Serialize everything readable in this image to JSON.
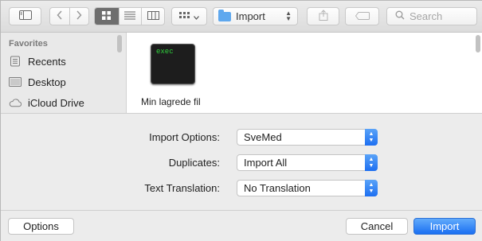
{
  "toolbar": {
    "sidebar_toggle_icon": "sidebar-icon",
    "back_icon": "chevron-left-icon",
    "forward_icon": "chevron-right-icon",
    "view_modes": [
      "icon-view",
      "list-view",
      "column-view"
    ],
    "active_view": "icon-view",
    "arrange_icon": "grid-arrange-icon",
    "location": "Import",
    "share_icon": "share-icon",
    "tag_icon": "tag-icon",
    "search_placeholder": "Search"
  },
  "sidebar": {
    "heading": "Favorites",
    "items": [
      {
        "label": "Recents",
        "icon": "recents-icon"
      },
      {
        "label": "Desktop",
        "icon": "desktop-icon"
      },
      {
        "label": "iCloud Drive",
        "icon": "cloud-icon"
      }
    ]
  },
  "files": [
    {
      "name": "Min lagrede fil",
      "badge": "exec"
    }
  ],
  "options": {
    "import_options_label": "Import Options:",
    "import_options_value": "SveMed",
    "duplicates_label": "Duplicates:",
    "duplicates_value": "Import All",
    "text_translation_label": "Text Translation:",
    "text_translation_value": "No Translation"
  },
  "buttons": {
    "options": "Options",
    "cancel": "Cancel",
    "import": "Import"
  },
  "colors": {
    "accent": "#1d6ff1",
    "exec_text": "#2fd03c"
  }
}
